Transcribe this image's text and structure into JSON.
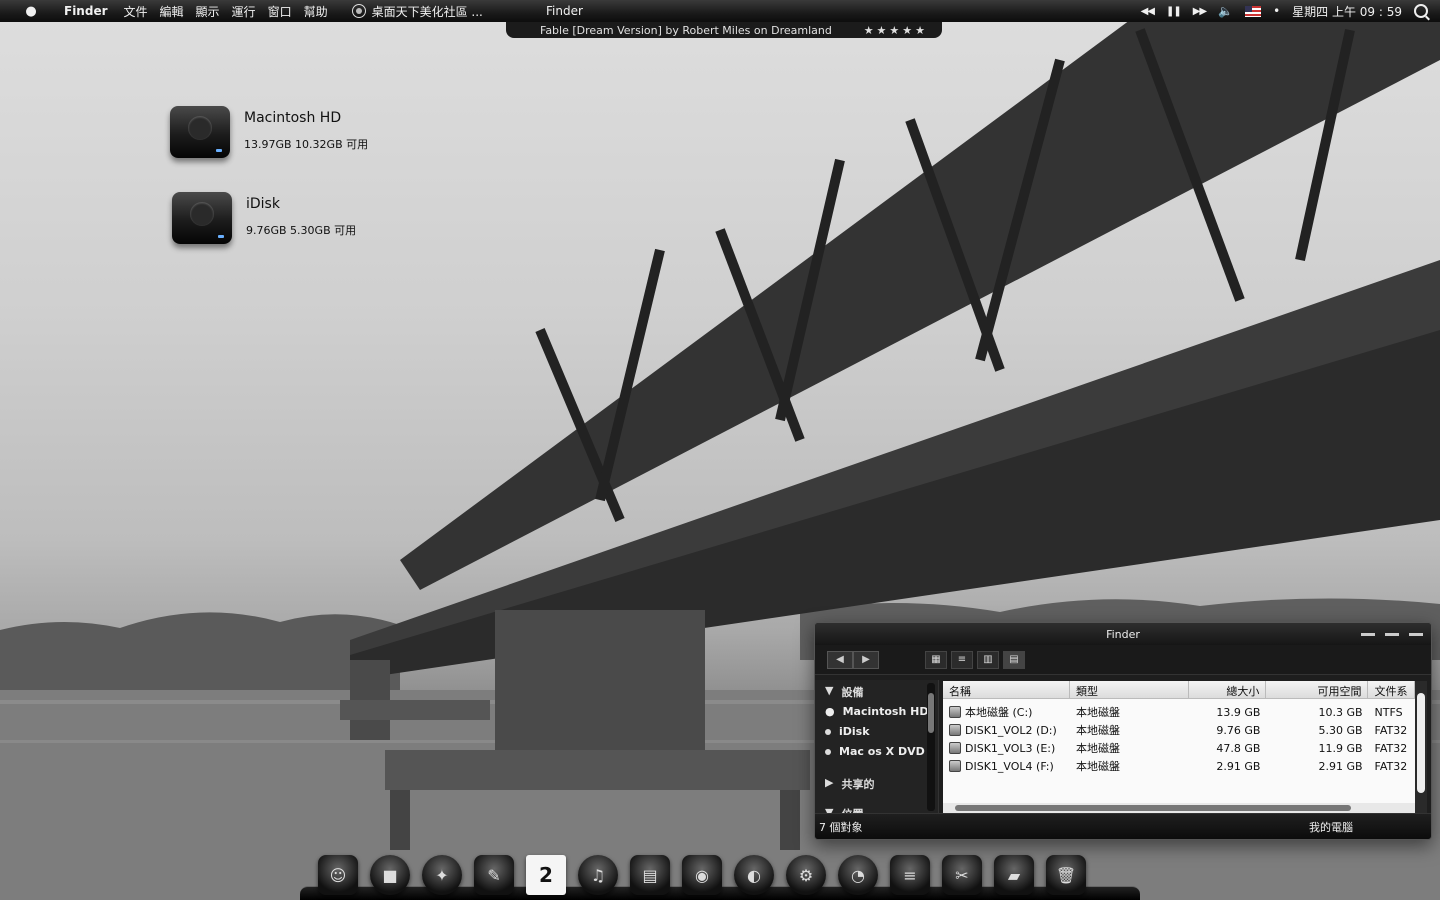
{
  "menubar": {
    "apple": "",
    "app_name": "Finder",
    "menus": [
      "文件",
      "編輯",
      "顯示",
      "運行",
      "窗口",
      "幫助"
    ],
    "site_title": "桌面天下美化社區 ...",
    "center_title": "Finder",
    "clock": "星期四 上午 09 : 59"
  },
  "now_playing": {
    "track": "Fable [Dream Version] by Robert Miles on Dreamland",
    "rating": "★★★★★"
  },
  "desktop": {
    "drives": [
      {
        "name": "Macintosh HD",
        "info": "13.97GB   10.32GB 可用"
      },
      {
        "name": "iDisk",
        "info": "9.76GB   5.30GB 可用"
      }
    ]
  },
  "finder": {
    "title": "Finder",
    "sidebar": {
      "devices_header": "設備",
      "items": [
        "Macintosh HD",
        "iDisk",
        "Mac os X DVD"
      ],
      "shared_header": "共享的",
      "places_header": "位置"
    },
    "columns": [
      "名稱",
      "類型",
      "總大小",
      "可用空間",
      "文件系"
    ],
    "rows": [
      {
        "name": "本地磁盤 (C:)",
        "type": "本地磁盤",
        "size": "13.9 GB",
        "free": "10.3 GB",
        "fs": "NTFS"
      },
      {
        "name": "DISK1_VOL2 (D:)",
        "type": "本地磁盤",
        "size": "9.76 GB",
        "free": "5.30 GB",
        "fs": "FAT32"
      },
      {
        "name": "DISK1_VOL3 (E:)",
        "type": "本地磁盤",
        "size": "47.8 GB",
        "free": "11.9 GB",
        "fs": "FAT32"
      },
      {
        "name": "DISK1_VOL4 (F:)",
        "type": "本地磁盤",
        "size": "2.91 GB",
        "free": "2.91 GB",
        "fs": "FAT32"
      }
    ],
    "status_left": "7 個對象",
    "status_right": "我的電腦"
  },
  "dock": {
    "calendar_day": "2"
  }
}
